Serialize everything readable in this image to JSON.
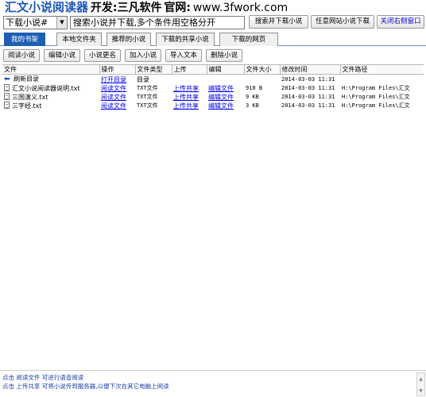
{
  "title": {
    "app_name": "汇文小说阅读器",
    "dev_label": "开发:三凡软件",
    "site_label": "官网:",
    "site_url": "www.3fwork.com"
  },
  "toolbar": {
    "mode_select": "下载小说#",
    "search_placeholder": "搜索小说并下载,多个条件用空格分开",
    "search_download_button": "搜索并下载小说",
    "any_site_download_button": "任意网站小说下载",
    "close_right_button": "关闭右侧窗口"
  },
  "tabs": [
    {
      "label": "我的书架",
      "active": true
    },
    {
      "label": "本地文件夹",
      "active": false
    },
    {
      "label": "推荐的小说",
      "active": false
    },
    {
      "label": "下载的共享小说",
      "active": false
    },
    {
      "label": "下载的网页",
      "active": false
    }
  ],
  "actions": [
    "阅读小说",
    "编辑小说",
    "小说更名",
    "加入小说",
    "导入文本",
    "删除小说"
  ],
  "table": {
    "columns": [
      "文件",
      "操作",
      "文件类型",
      "上传",
      "编辑",
      "文件大小",
      "修改时间",
      "文件路径"
    ],
    "rows": [
      {
        "file": "刷新目录",
        "icon": "back-arrow-icon",
        "action": "打开目录",
        "type": "目录",
        "upload": "",
        "edit": "",
        "size": "",
        "modified": "2014-03-03 11:31",
        "path": ""
      },
      {
        "file": "汇文小说阅读器说明.txt",
        "icon": "text-file-icon",
        "action": "阅读文件",
        "type": "TXT文件",
        "upload": "上传共享",
        "edit": "编辑文件",
        "size": "910 B",
        "modified": "2014-03-03 11:31",
        "path": "H:\\Program Files\\汇文"
      },
      {
        "file": "三国演义.txt",
        "icon": "text-file-icon",
        "action": "阅读文件",
        "type": "TXT文件",
        "upload": "上传共享",
        "edit": "编辑文件",
        "size": "9 KB",
        "modified": "2014-03-03 11:31",
        "path": "H:\\Program Files\\汇文"
      },
      {
        "file": "三字经.txt",
        "icon": "text-file-icon",
        "action": "阅读文件",
        "type": "TXT文件",
        "upload": "上传共享",
        "edit": "编辑文件",
        "size": "3 KB",
        "modified": "2014-03-03 11:31",
        "path": "H:\\Program Files\\汇文"
      }
    ]
  },
  "status": {
    "line1": "点击 阅读文件 可进行语音阅读",
    "line2": "点击 上传共享 可将小说传到服务器,以便下次在其它电脑上阅读"
  }
}
